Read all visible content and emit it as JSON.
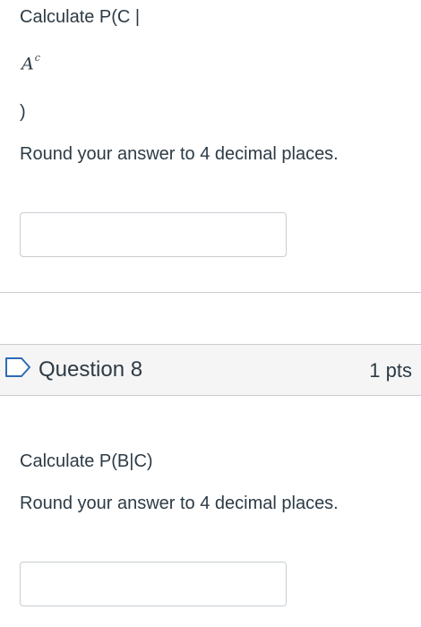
{
  "question7": {
    "prompt_prefix": "Calculate P(C |",
    "math_base": "A",
    "math_superscript": "c",
    "prompt_suffix": ")",
    "rounding_note": "Round your answer to 4 decimal places.",
    "answer_value": ""
  },
  "question8": {
    "title": "Question 8",
    "points": "1 pts",
    "flag_icon": "flag-outline-icon",
    "prompt": "Calculate P(B|C)",
    "rounding_note": "Round your answer to 4 decimal places.",
    "answer_value": ""
  },
  "colors": {
    "text": "#2d3b45",
    "border": "#c7cdd1",
    "header_bg": "#f5f5f5"
  }
}
